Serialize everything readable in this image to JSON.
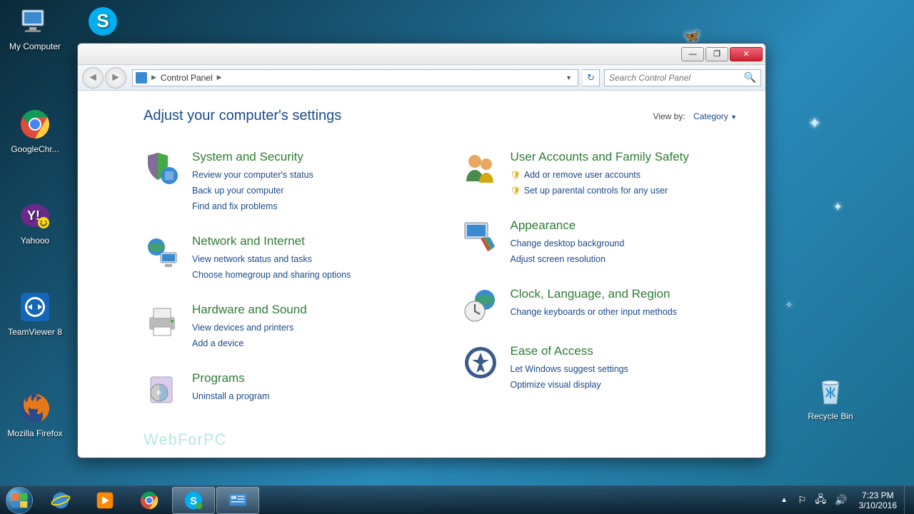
{
  "desktop_icons": {
    "my_computer": "My Computer",
    "skype": "",
    "google_chrome": "GoogleChr...",
    "yahoo": "Yahooo",
    "teamviewer8": "TeamViewer 8",
    "firefox": "Mozilla Firefox",
    "recycle_bin": "Recycle Bin"
  },
  "window": {
    "breadcrumb": "Control Panel",
    "search_placeholder": "Search Control Panel",
    "heading": "Adjust your computer's settings",
    "view_by_label": "View by:",
    "view_by_value": "Category",
    "watermark": "WebForPC",
    "categories": {
      "system_security": {
        "title": "System and Security",
        "links": [
          "Review your computer's status",
          "Back up your computer",
          "Find and fix problems"
        ]
      },
      "network": {
        "title": "Network and Internet",
        "links": [
          "View network status and tasks",
          "Choose homegroup and sharing options"
        ]
      },
      "hardware": {
        "title": "Hardware and Sound",
        "links": [
          "View devices and printers",
          "Add a device"
        ]
      },
      "programs": {
        "title": "Programs",
        "links": [
          "Uninstall a program"
        ]
      },
      "user_accounts": {
        "title": "User Accounts and Family Safety",
        "links": [
          "Add or remove user accounts",
          "Set up parental controls for any user"
        ]
      },
      "appearance": {
        "title": "Appearance",
        "links": [
          "Change desktop background",
          "Adjust screen resolution"
        ]
      },
      "clock": {
        "title": "Clock, Language, and Region",
        "links": [
          "Change keyboards or other input methods"
        ]
      },
      "ease": {
        "title": "Ease of Access",
        "links": [
          "Let Windows suggest settings",
          "Optimize visual display"
        ]
      }
    }
  },
  "taskbar": {
    "time": "7:23 PM",
    "date": "3/10/2016"
  }
}
